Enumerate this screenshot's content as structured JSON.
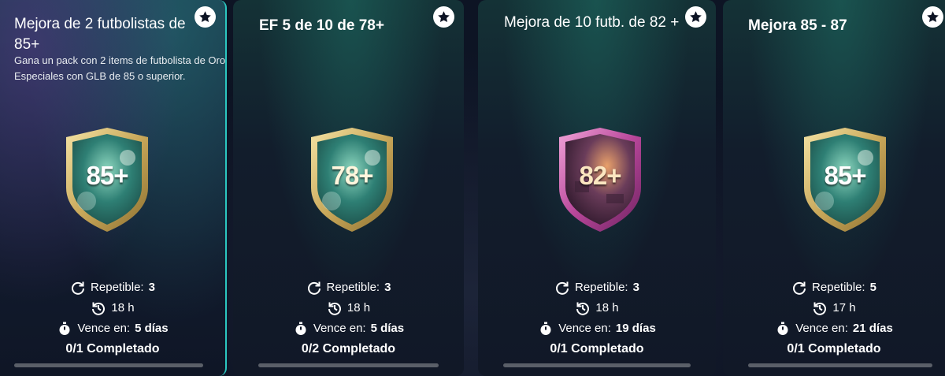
{
  "cards": [
    {
      "title": "Mejora de 2 futbolistas de 85+",
      "description": "Gana un pack con 2 items de futbolista de Oro Especiales con GLB de 85 o superior.",
      "badge_text": "85+",
      "badge_style": "gold-green",
      "repeat_label": "Repetible:",
      "repeat_value": "3",
      "refresh": "18 h",
      "expires_label": "Vence en:",
      "expires_value": "5 días",
      "completed": "0/1 Completado",
      "progress": 0
    },
    {
      "title": "EF 5 de 10 de 78+",
      "description": "",
      "badge_text": "78+",
      "badge_style": "gold-green",
      "repeat_label": "Repetible:",
      "repeat_value": "3",
      "refresh": "18 h",
      "expires_label": "Vence en:",
      "expires_value": "5 días",
      "completed": "0/2 Completado",
      "progress": 0
    },
    {
      "title": "Mejora de 10 futb. de 82 +",
      "description": "",
      "badge_text": "82+",
      "badge_style": "pink-purple",
      "repeat_label": "Repetible:",
      "repeat_value": "3",
      "refresh": "18 h",
      "expires_label": "Vence en:",
      "expires_value": "19 días",
      "completed": "0/1 Completado",
      "progress": 0
    },
    {
      "title": "Mejora 85 - 87",
      "description": "",
      "badge_text": "85+",
      "badge_style": "gold-green",
      "repeat_label": "Repetible:",
      "repeat_value": "5",
      "refresh": "17 h",
      "expires_label": "Vence en:",
      "expires_value": "21 días",
      "completed": "0/1 Completado",
      "progress": 0
    }
  ],
  "icons": {
    "favorite": "star-icon",
    "repeat": "repeat-icon",
    "refresh": "history-icon",
    "expires": "stopwatch-icon"
  },
  "colors": {
    "selected_border": "#2bc7c0",
    "gold": "#d8c27a",
    "pink": "#c04fa0",
    "progress_track": "#5a5f68"
  }
}
